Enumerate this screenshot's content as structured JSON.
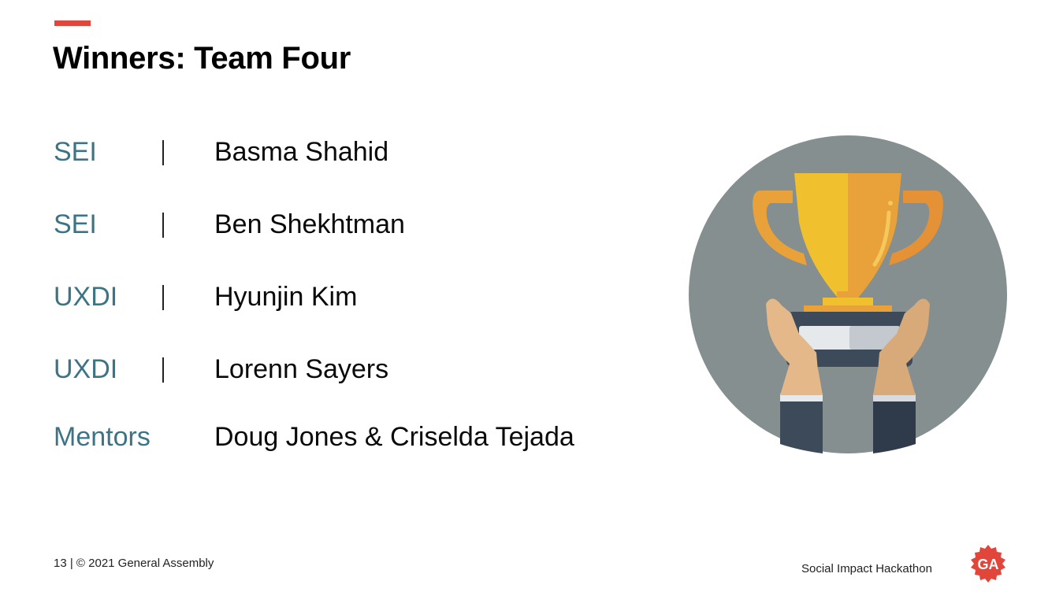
{
  "slide": {
    "title": "Winners: Team Four",
    "members": [
      {
        "role": "SEI",
        "name": "Basma Shahid"
      },
      {
        "role": "SEI",
        "name": "Ben Shekhtman"
      },
      {
        "role": "UXDI",
        "name": "Hyunjin Kim"
      },
      {
        "role": "UXDI",
        "name": "Lorenn Sayers"
      }
    ],
    "mentors": {
      "role": "Mentors",
      "names": "Doug Jones & Criselda Tejada"
    }
  },
  "footer": {
    "left": "13 | © 2021 General Assembly",
    "right": "Social Impact Hackathon",
    "logo_text": "GA"
  },
  "icons": {
    "illustration": "trophy-icon",
    "logo": "general-assembly-logo"
  },
  "colors": {
    "accent": "#e2453a",
    "role_text": "#3c7486",
    "circle": "#858f90",
    "trophy_gold": "#f0c02f",
    "trophy_orange": "#e9a13a",
    "logo_red": "#e2453a"
  }
}
